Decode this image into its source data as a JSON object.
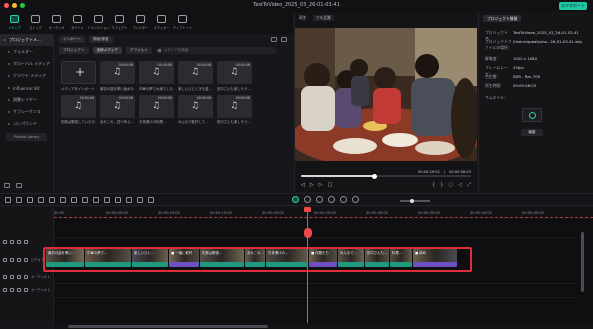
{
  "titlebar": {
    "title": "TestToVideo_2025_03_26-01-03-41",
    "export_label": "エクスポート",
    "traffic_colors": [
      "#ff5f57",
      "#febc2e",
      "#28c840"
    ]
  },
  "toolbar": {
    "items": [
      {
        "label": "メディア",
        "icon": "media-icon"
      },
      {
        "label": "ストック",
        "icon": "stock-icon"
      },
      {
        "label": "オーディオ",
        "icon": "audio-icon"
      },
      {
        "label": "タイトル",
        "icon": "title-icon"
      },
      {
        "label": "トランジション",
        "icon": "transition-icon"
      },
      {
        "label": "エフェクト",
        "icon": "effect-icon"
      },
      {
        "label": "フィルター",
        "icon": "filter-icon"
      },
      {
        "label": "ステッカー",
        "icon": "sticker-icon"
      },
      {
        "label": "テンプレート",
        "icon": "template-icon"
      }
    ]
  },
  "sidebar": {
    "items": [
      {
        "label": "プロジェクトメ..."
      },
      {
        "label": "フォルダー"
      },
      {
        "label": "グローバル メディア"
      },
      {
        "label": "クラウド メディア"
      },
      {
        "label": "Influencer Kit"
      },
      {
        "label": "調整レイヤー"
      },
      {
        "label": "サブシーケンス"
      },
      {
        "label": "コンパウンド"
      }
    ],
    "photo_library": "Photos Library"
  },
  "media": {
    "import_label": "インポート",
    "record_label": "録画/録音",
    "tab_project": "プロジェクト",
    "tab_global": "全体メディア",
    "sort_label": "デフォルト",
    "search_placeholder": "メディアを検索",
    "items": [
      {
        "caption": "メディアをインポート",
        "duration": "",
        "import": true
      },
      {
        "caption": "最初の曲を歌い始めた...",
        "duration": "00:00:08"
      },
      {
        "caption": "中華の夢で大漁でした...",
        "duration": "00:00:08"
      },
      {
        "caption": "楽しいひとときを過...",
        "duration": "00:00:08"
      },
      {
        "caption": "田中さんも楽しそう...",
        "duration": "00:00:08"
      },
      {
        "caption": "佐藤は緊張していたが...",
        "duration": "00:00:08"
      },
      {
        "caption": "あれこれ、四十年ぶ...",
        "duration": "00:00:08"
      },
      {
        "caption": "お茶漬けの料理...",
        "duration": "00:00:08"
      },
      {
        "caption": "みんなで乾杯して...",
        "duration": "00:00:08"
      },
      {
        "caption": "田中さんも楽しそう...",
        "duration": "00:00:08"
      }
    ]
  },
  "player": {
    "tab": "再生",
    "quality": "フル品質",
    "current_time": "00:00:29:02",
    "total_time": "00:00:58:03",
    "progress_fraction": 0.43
  },
  "props": {
    "tab_label": "プロジェクト情報",
    "rows": [
      {
        "k": "プロジェクト名：",
        "v": "TestToVideo_2025_03_26-01-03-41"
      },
      {
        "k": "プロジェクトファイルの場所：",
        "v": "/Users/wpeatysha...26-01-03-41.wfp"
      },
      {
        "k": "解像度：",
        "v": "1920 x 1080"
      },
      {
        "k": "フレームレート：",
        "v": "25fps"
      },
      {
        "k": "色空間：",
        "v": "SDR - Rec.709"
      },
      {
        "k": "再生時間：",
        "v": "00:00:48:03"
      },
      {
        "k": "サムネイル：",
        "v": ""
      }
    ],
    "edit_label": "編集"
  },
  "timeline": {
    "ruler_ticks": [
      "00:00",
      "00:00:05:00",
      "00:00:10:00",
      "00:00:15:00",
      "00:00:20:00",
      "00:00:25:00",
      "00:00:30:00",
      "00:00:35:00",
      "00:00:40:00",
      "00:00:45:00"
    ],
    "tracks": [
      {
        "label": "ビデオ 1"
      },
      {
        "label": "オーディオ 1"
      },
      {
        "label": "オーディオ 2"
      }
    ],
    "clips": [
      {
        "label": "最初の曲を歌い...",
        "bar": "#1f9a7e",
        "w": 38
      },
      {
        "label": "中華の夢で...",
        "bar": "#1f9a7e",
        "w": 46
      },
      {
        "label": "楽しいひと...",
        "bar": "#1f9a7e",
        "w": 36
      },
      {
        "label": "■ 一緒に乾杯",
        "bar": "#6f4fc2",
        "w": 30
      },
      {
        "label": "佐藤は緊張...",
        "bar": "#1f9a7e",
        "w": 44
      },
      {
        "label": "あれこれ...",
        "bar": "#1f9a7e",
        "w": 20
      },
      {
        "label": "お茶漬けの...",
        "bar": "#1f9a7e",
        "w": 42
      },
      {
        "label": "■ 仲間たち",
        "bar": "#6f4fc2",
        "w": 28
      },
      {
        "label": "みんなで...",
        "bar": "#1f9a7e",
        "w": 26
      },
      {
        "label": "田中さんも...",
        "bar": "#1f9a7e",
        "w": 24
      },
      {
        "label": "料理...",
        "bar": "#1f9a7e",
        "w": 22
      },
      {
        "label": "■ 締め",
        "bar": "#6f4fc2",
        "w": 44
      }
    ]
  }
}
